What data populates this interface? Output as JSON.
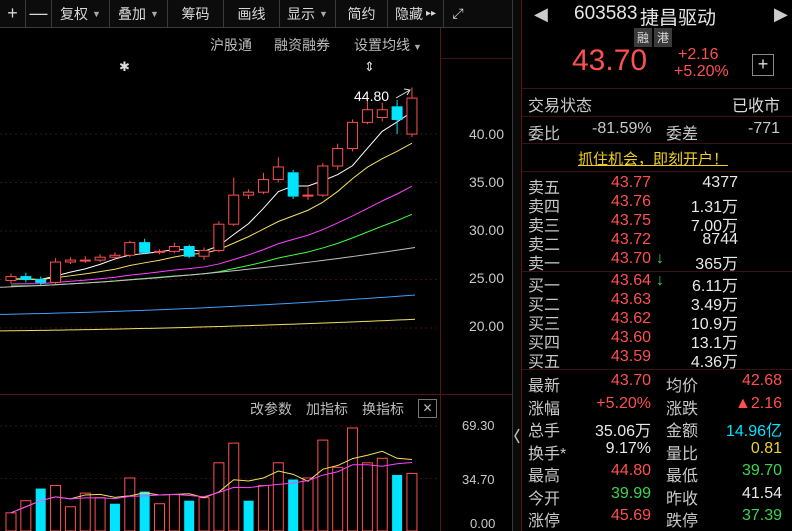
{
  "toolbar": {
    "items": [
      {
        "label": "+",
        "has_caret": false
      },
      {
        "label": "—",
        "has_caret": false
      },
      {
        "label": "复权",
        "has_caret": true
      },
      {
        "label": "叠加",
        "has_caret": true
      },
      {
        "label": "筹码",
        "has_caret": false
      },
      {
        "label": "画线",
        "has_caret": false
      },
      {
        "label": "显示",
        "has_caret": true
      },
      {
        "label": "简约",
        "has_caret": false
      },
      {
        "label": "隐藏",
        "has_caret": false
      }
    ],
    "collapse_glyph": "▸▸",
    "expand_glyph": "⤢"
  },
  "subbar": {
    "links": [
      "沪股通",
      "融资融券",
      "设置均线"
    ]
  },
  "price_axis": [
    "40.00",
    "35.00",
    "30.00",
    "25.00",
    "20.00"
  ],
  "high_annotation": "44.80",
  "indicator_bar": {
    "links": [
      "改参数",
      "加指标",
      "换指标"
    ],
    "close_glyph": "✕"
  },
  "volume_axis": [
    "69.30",
    "34.70",
    "0.00"
  ],
  "stock": {
    "code": "603583",
    "name": "捷昌驱动",
    "badges": [
      "融",
      "港"
    ],
    "price": "43.70",
    "change": "+2.16",
    "change_pct": "+5.20%",
    "add_glyph": "+"
  },
  "trade_status": {
    "label": "交易状态",
    "value": "已收市"
  },
  "ratio": {
    "wb_label": "委比",
    "wb_value": "-81.59%",
    "wc_label": "委差",
    "wc_value": "-771"
  },
  "promo": "抓住机会，即刻开户！",
  "order_book": {
    "asks": [
      {
        "label": "卖五",
        "price": "43.77",
        "volume": "4377",
        "arrow": ""
      },
      {
        "label": "卖四",
        "price": "43.76",
        "volume": "1.31万",
        "arrow": ""
      },
      {
        "label": "卖三",
        "price": "43.75",
        "volume": "7.00万",
        "arrow": ""
      },
      {
        "label": "卖二",
        "price": "43.72",
        "volume": "8744",
        "arrow": ""
      },
      {
        "label": "卖一",
        "price": "43.70",
        "volume": "365万",
        "arrow": "↓"
      }
    ],
    "bids": [
      {
        "label": "买一",
        "price": "43.64",
        "volume": "6.11万",
        "arrow": "↓"
      },
      {
        "label": "买二",
        "price": "43.63",
        "volume": "3.49万",
        "arrow": ""
      },
      {
        "label": "买三",
        "price": "43.62",
        "volume": "10.9万",
        "arrow": ""
      },
      {
        "label": "买四",
        "price": "43.60",
        "volume": "13.1万",
        "arrow": ""
      },
      {
        "label": "买五",
        "price": "43.59",
        "volume": "4.36万",
        "arrow": ""
      }
    ]
  },
  "stats": [
    {
      "l1": "最新",
      "v1": "43.70",
      "c1": "red",
      "l2": "均价",
      "v2": "42.68",
      "c2": "red"
    },
    {
      "l1": "涨幅",
      "v1": "+5.20%",
      "c1": "red",
      "l2": "涨跌",
      "v2": "▲2.16",
      "c2": "red"
    },
    {
      "l1": "总手",
      "v1": "35.06万",
      "c1": "white",
      "l2": "金额",
      "v2": "14.96亿",
      "c2": "cyan"
    },
    {
      "l1": "换手*",
      "v1": "9.17%",
      "c1": "white",
      "l2": "量比",
      "v2": "0.81",
      "c2": "yellow"
    },
    {
      "l1": "最高",
      "v1": "44.80",
      "c1": "red",
      "l2": "最低",
      "v2": "39.70",
      "c2": "green"
    },
    {
      "l1": "今开",
      "v1": "39.99",
      "c1": "green",
      "l2": "昨收",
      "v2": "41.54",
      "c2": "white"
    },
    {
      "l1": "涨停",
      "v1": "45.69",
      "c1": "red",
      "l2": "跌停",
      "v2": "37.39",
      "c2": "green"
    }
  ],
  "colors": {
    "up": "#ff4f4f",
    "down": "#00e5ff",
    "ma5": "#ffffff",
    "ma10": "#f0e060",
    "ma20": "#ff40ff",
    "ma30": "#40ff40",
    "ma60": "#c0c0c0",
    "ma120": "#3aa0ff",
    "ma250": "#f0e060"
  },
  "candles": [
    {
      "o": 24.9,
      "c": 25.3,
      "h": 25.6,
      "l": 24.6
    },
    {
      "o": 25.3,
      "c": 25.0,
      "h": 25.7,
      "l": 24.7
    },
    {
      "o": 25.0,
      "c": 24.7,
      "h": 25.3,
      "l": 24.4
    },
    {
      "o": 24.7,
      "c": 26.8,
      "h": 27.2,
      "l": 24.5
    },
    {
      "o": 26.8,
      "c": 27.0,
      "h": 27.3,
      "l": 26.6
    },
    {
      "o": 27.0,
      "c": 27.0,
      "h": 27.4,
      "l": 26.7
    },
    {
      "o": 27.0,
      "c": 27.3,
      "h": 27.6,
      "l": 26.8
    },
    {
      "o": 27.3,
      "c": 27.5,
      "h": 27.8,
      "l": 27.0
    },
    {
      "o": 27.5,
      "c": 28.8,
      "h": 29.0,
      "l": 27.3
    },
    {
      "o": 28.8,
      "c": 27.8,
      "h": 29.2,
      "l": 27.6
    },
    {
      "o": 27.8,
      "c": 27.9,
      "h": 28.1,
      "l": 27.6
    },
    {
      "o": 27.9,
      "c": 28.4,
      "h": 28.8,
      "l": 27.7
    },
    {
      "o": 28.4,
      "c": 27.4,
      "h": 28.6,
      "l": 27.2
    },
    {
      "o": 27.4,
      "c": 28.0,
      "h": 28.3,
      "l": 27.0
    },
    {
      "o": 28.0,
      "c": 30.7,
      "h": 31.0,
      "l": 27.8
    },
    {
      "o": 30.7,
      "c": 33.7,
      "h": 35.5,
      "l": 30.5
    },
    {
      "o": 33.7,
      "c": 34.0,
      "h": 34.3,
      "l": 33.3
    },
    {
      "o": 34.0,
      "c": 35.3,
      "h": 36.0,
      "l": 33.8
    },
    {
      "o": 35.3,
      "c": 36.6,
      "h": 37.6,
      "l": 35.0
    },
    {
      "o": 36.0,
      "c": 33.6,
      "h": 36.3,
      "l": 33.3
    },
    {
      "o": 33.6,
      "c": 33.7,
      "h": 34.5,
      "l": 33.2
    },
    {
      "o": 33.7,
      "c": 36.7,
      "h": 37.0,
      "l": 33.5
    },
    {
      "o": 36.7,
      "c": 38.5,
      "h": 39.0,
      "l": 36.3
    },
    {
      "o": 38.5,
      "c": 41.2,
      "h": 41.5,
      "l": 38.2
    },
    {
      "o": 41.2,
      "c": 42.5,
      "h": 43.5,
      "l": 41.0
    },
    {
      "o": 41.7,
      "c": 42.5,
      "h": 43.2,
      "l": 41.3
    },
    {
      "o": 42.8,
      "c": 41.5,
      "h": 43.5,
      "l": 40.0
    },
    {
      "o": 39.99,
      "c": 43.7,
      "h": 44.8,
      "l": 39.7
    }
  ],
  "volumes": [
    {
      "v": 12,
      "up": true
    },
    {
      "v": 20,
      "up": true
    },
    {
      "v": 28,
      "up": false
    },
    {
      "v": 30,
      "up": true
    },
    {
      "v": 16,
      "up": true
    },
    {
      "v": 25,
      "up": true
    },
    {
      "v": 22,
      "up": true
    },
    {
      "v": 18,
      "up": false
    },
    {
      "v": 35,
      "up": true
    },
    {
      "v": 26,
      "up": false
    },
    {
      "v": 18,
      "up": true
    },
    {
      "v": 24,
      "up": true
    },
    {
      "v": 20,
      "up": false
    },
    {
      "v": 22,
      "up": true
    },
    {
      "v": 45,
      "up": true
    },
    {
      "v": 58,
      "up": true
    },
    {
      "v": 20,
      "up": false
    },
    {
      "v": 30,
      "up": true
    },
    {
      "v": 45,
      "up": true
    },
    {
      "v": 34,
      "up": false
    },
    {
      "v": 35,
      "up": true
    },
    {
      "v": 60,
      "up": true
    },
    {
      "v": 42,
      "up": true
    },
    {
      "v": 68,
      "up": true
    },
    {
      "v": 45,
      "up": true
    },
    {
      "v": 48,
      "up": true
    },
    {
      "v": 37,
      "up": false
    },
    {
      "v": 38,
      "up": true
    }
  ]
}
